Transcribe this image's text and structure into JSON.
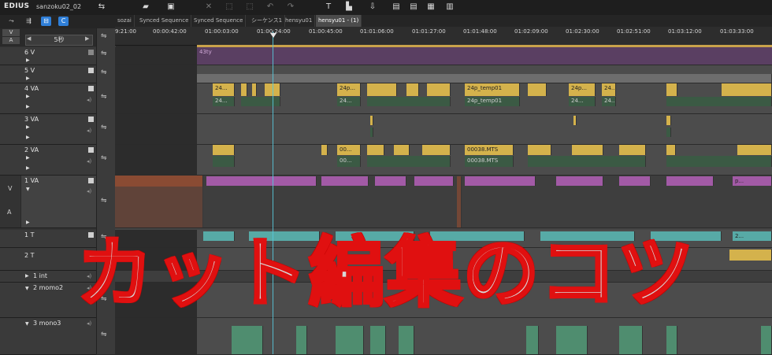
{
  "app": {
    "name": "EDIUS",
    "project": "sanzoku02_02"
  },
  "toolbar": {
    "icons": [
      "timeline-mode-icon",
      "folder-open-icon",
      "save-icon",
      "cut-icon",
      "crop-icon",
      "undo-icon",
      "redo-icon",
      "title-icon",
      "color-icon",
      "export-icon",
      "marker-icon",
      "subtitle-icon",
      "effect-icon",
      "mixer-icon"
    ]
  },
  "left_panel": {
    "v_label": "V",
    "a_label": "A",
    "scale": "5秒",
    "scale_left": "◀",
    "scale_right": "▶",
    "side_v": "V",
    "side_a": "A",
    "tracks": [
      {
        "name": "6 V"
      },
      {
        "name": "5 V"
      },
      {
        "name": "4 VA"
      },
      {
        "name": "3 VA"
      },
      {
        "name": "2 VA"
      },
      {
        "name": "1 VA"
      },
      {
        "name": "1 T"
      },
      {
        "name": "2 T"
      },
      {
        "name": "1 int"
      },
      {
        "name": "2 momo2"
      },
      {
        "name": "3 mono3"
      }
    ]
  },
  "tabs": [
    {
      "label": "sozai"
    },
    {
      "label": "Synced Sequence"
    },
    {
      "label": "Synced Sequence"
    },
    {
      "label": "シーケンス1"
    },
    {
      "label": "hensyu01"
    },
    {
      "label": "hensyu01 - (1)",
      "active": true
    }
  ],
  "ruler": {
    "timecodes": [
      "9:21:00",
      "00:00:42:00",
      "01:00:03:00",
      "01:00:24:00",
      "01:00:45:00",
      "01:01:06:00",
      "01:01:27:00",
      "01:01:48:00",
      "01:02:09:00",
      "01:02:30:00",
      "01:02:51:00",
      "01:03:12:00",
      "01:03:33:00"
    ]
  },
  "clips": {
    "title_track": "43ty",
    "va4": [
      "24...",
      "24p...",
      "24p_temp01",
      "24p...",
      "24..."
    ],
    "va4_sub": [
      "24...",
      "24...",
      "24p_temp01",
      "24...",
      "24..."
    ],
    "va2": [
      "00...",
      "00038.MTS"
    ],
    "va2_sub": [
      "00...",
      "00038.MTS"
    ],
    "va1": [
      "p..."
    ],
    "t1": [
      "2..."
    ]
  },
  "overlay": {
    "title": "カット編集のコツ"
  },
  "colors": {
    "clip_yellow": "#d4b24c",
    "clip_pink": "#a25aa6",
    "clip_teal": "#57aaa6",
    "playhead": "#58c7d9",
    "title_outline": "#e01010"
  }
}
